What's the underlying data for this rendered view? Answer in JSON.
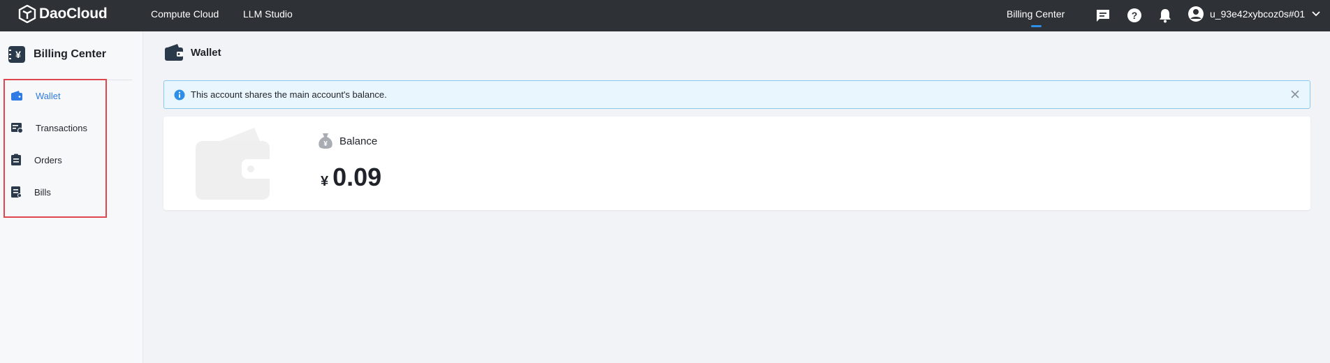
{
  "topbar": {
    "brand": "DaoCloud",
    "nav": [
      {
        "label": "Compute Cloud"
      },
      {
        "label": "LLM Studio"
      }
    ],
    "active_tab": "Billing Center",
    "username": "u_93e42xybcoz0s#01",
    "icons": [
      "message-icon",
      "help-icon",
      "bell-icon",
      "user-avatar-icon",
      "chevron-down-icon"
    ]
  },
  "sidebar": {
    "title": "Billing Center",
    "items": [
      {
        "label": "Wallet",
        "icon": "wallet-icon",
        "active": true
      },
      {
        "label": "Transactions",
        "icon": "transactions-icon",
        "active": false
      },
      {
        "label": "Orders",
        "icon": "orders-icon",
        "active": false
      },
      {
        "label": "Bills",
        "icon": "bills-icon",
        "active": false
      }
    ]
  },
  "main": {
    "title": "Wallet",
    "alert": "This account shares the main account's balance.",
    "balance": {
      "label": "Balance",
      "currency": "¥",
      "value": "0.09"
    }
  },
  "colors": {
    "topbar_bg": "#2e3236",
    "accent": "#2f7be6",
    "highlight_border": "#e0464d",
    "alert_bg": "#eaf6fd",
    "alert_border": "#8cc8ee"
  }
}
